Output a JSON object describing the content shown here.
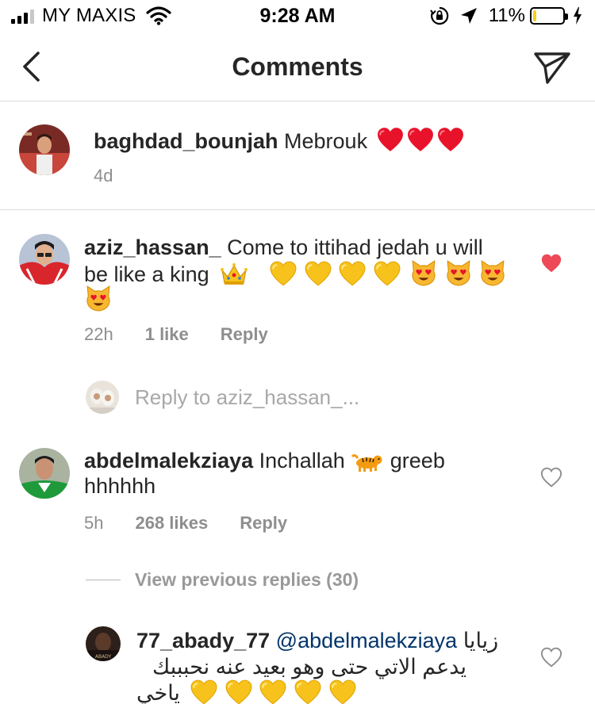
{
  "status_bar": {
    "carrier": "MY MAXIS",
    "time": "9:28 AM",
    "battery_percent": "11%",
    "battery_level": 0.11,
    "icons": [
      "signal-icon",
      "wifi-icon",
      "orientation-lock-icon",
      "location-icon",
      "battery-icon",
      "charging-icon"
    ]
  },
  "header": {
    "title": "Comments",
    "back_icon": "chevron-left-icon",
    "send_icon": "paper-plane-icon"
  },
  "caption": {
    "username": "baghdad_bounjah",
    "text": "Mebrouk",
    "emoji": "red-heart x3",
    "age": "4d"
  },
  "comments": [
    {
      "username": "aziz_hassan_",
      "text_line1": "Come to ittihad jedah u will",
      "text_line2": "be like a king",
      "emoji": "crown, yellow-heart x4, heart-eyes-cat x4",
      "age": "22h",
      "likes": "1 like",
      "reply_label": "Reply",
      "liked": true
    },
    {
      "username": "abdelmalekziaya",
      "text_line1": "Inchallah",
      "text_line1b": "greeb",
      "text_line2": "hhhhhh",
      "emoji": "tiger",
      "age": "5h",
      "likes": "268 likes",
      "reply_label": "Reply",
      "liked": false
    }
  ],
  "reply_composer": {
    "placeholder": "Reply to aziz_hassan_..."
  },
  "view_previous": {
    "label": "View previous replies (30)"
  },
  "reply": {
    "username": "77_abady_77",
    "mention": "@abdelmalekziaya",
    "text_line1_tail": "زيايا",
    "text_line2": "يدعم الاتي حتى وهو بعيد عنه نحبببك",
    "text_line3": "ياخي",
    "emoji": "yellow-heart x5",
    "liked": false
  },
  "colors": {
    "like_red": "#ed4956",
    "muted": "#8e8e8e",
    "mention": "#003569",
    "battery_yellow": "#f4cf1a"
  }
}
